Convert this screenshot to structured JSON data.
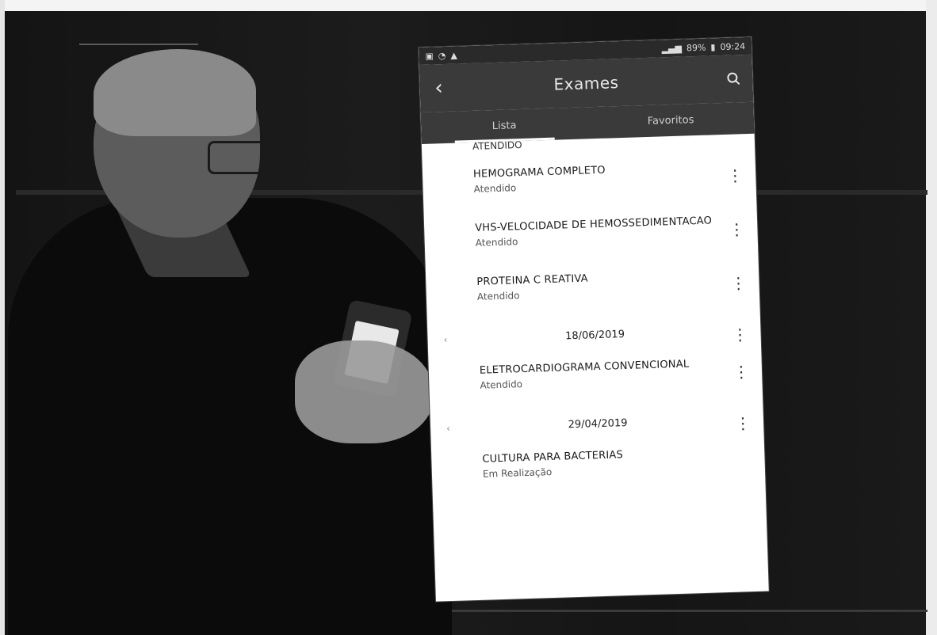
{
  "status_bar": {
    "left_icons": [
      "sim-icon",
      "notification-icon",
      "wifi-icon"
    ],
    "signal_text": "",
    "battery_text": "89%",
    "time": "09:24"
  },
  "app_bar": {
    "title": "Exames",
    "back_icon": "chevron-left-icon",
    "search_icon": "search-icon"
  },
  "tabs": [
    {
      "label": "Lista",
      "active": true
    },
    {
      "label": "Favoritos",
      "active": false
    }
  ],
  "truncated_row_text": "ATENDIDO",
  "list_items": [
    {
      "name": "HEMOGRAMA COMPLETO",
      "status": "Atendido"
    },
    {
      "name": "VHS-VELOCIDADE DE HEMOSSEDIMENTACAO",
      "status": "Atendido"
    },
    {
      "name": "PROTEINA C REATIVA",
      "status": "Atendido"
    }
  ],
  "date_groups": [
    {
      "date": "18/06/2019",
      "items": [
        {
          "name": "ELETROCARDIOGRAMA CONVENCIONAL",
          "status": "Atendido"
        }
      ]
    },
    {
      "date": "29/04/2019",
      "items": [
        {
          "name": "CULTURA PARA BACTERIAS",
          "status": "Em Realização"
        }
      ]
    }
  ],
  "colors": {
    "app_bar": "#3a3a3a",
    "list_background": "#ffffff"
  }
}
